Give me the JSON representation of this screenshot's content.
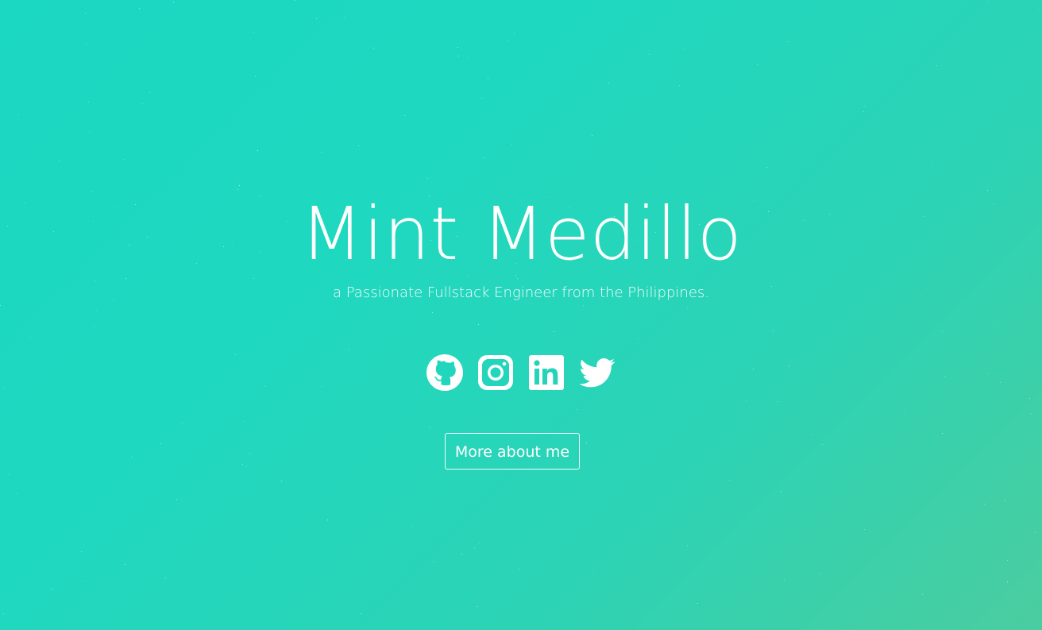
{
  "hero": {
    "title": "Mint Medillo",
    "subtitle": "a Passionate Fullstack Engineer from the Philippines."
  },
  "socials": [
    {
      "name": "github",
      "icon": "github-icon"
    },
    {
      "name": "instagram",
      "icon": "instagram-icon"
    },
    {
      "name": "linkedin",
      "icon": "linkedin-icon"
    },
    {
      "name": "twitter",
      "icon": "twitter-icon"
    }
  ],
  "cta": {
    "more_label": "More about me"
  },
  "colors": {
    "gradient_start": "#1bd8c2",
    "gradient_end": "#4bcd9f",
    "foreground": "#ffffff"
  }
}
